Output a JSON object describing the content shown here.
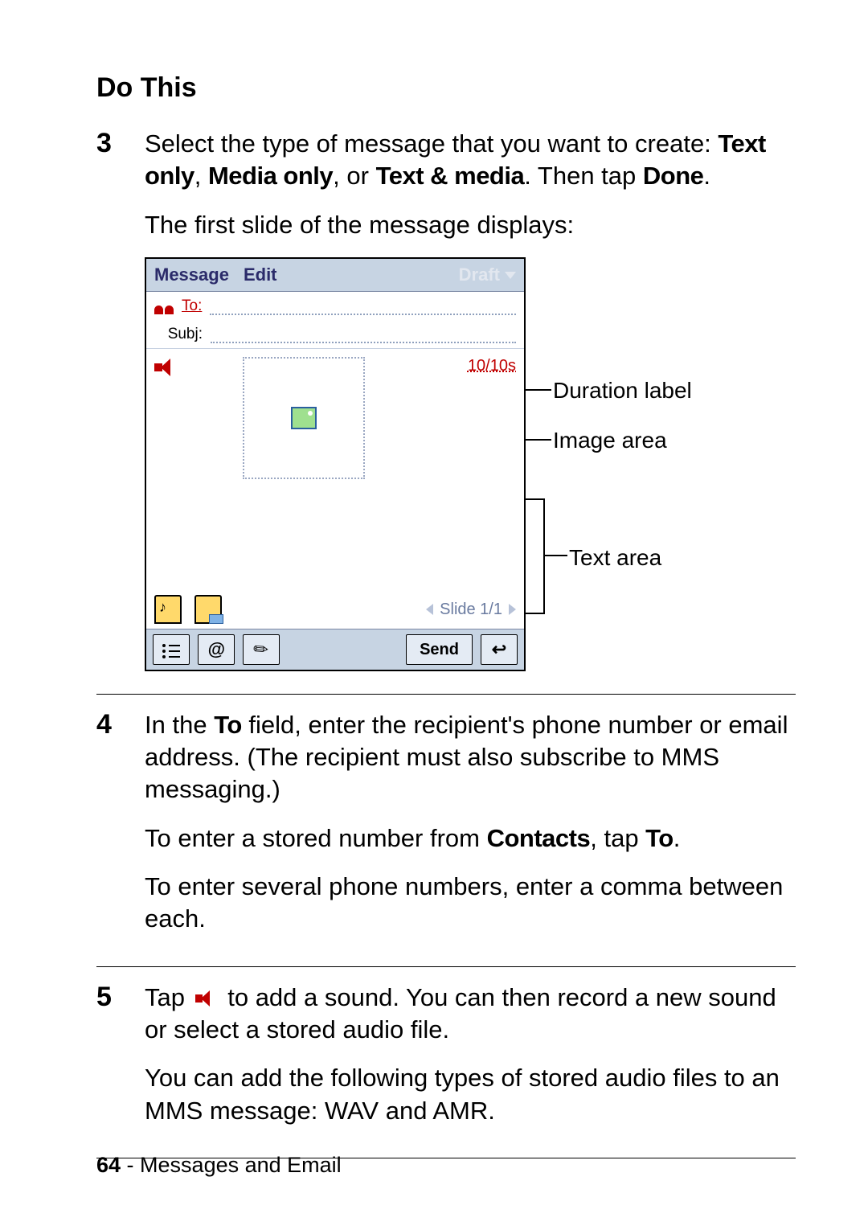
{
  "heading": "Do This",
  "steps": {
    "s3": {
      "num": "3",
      "p1_a": "Select the type of message that you want to create: ",
      "opt1": "Text only",
      "sep1": ", ",
      "opt2": "Media only",
      "sep2": ", or ",
      "opt3": "Text & media",
      "p1_b": ". Then tap ",
      "done": "Done",
      "p1_c": ".",
      "p2": "The first slide of the message displays:"
    },
    "s4": {
      "num": "4",
      "p1_a": "In the ",
      "to_bold": "To",
      "p1_b": " field, enter the recipient's phone number or email address. (The recipient must also subscribe to MMS messaging.)",
      "p2_a": "To enter a stored number from ",
      "contacts": "Contacts",
      "p2_b": ", tap ",
      "to_bold2": "To",
      "p2_c": ".",
      "p3": "To enter several phone numbers, enter a comma between each."
    },
    "s5": {
      "num": "5",
      "p1_a": "Tap ",
      "p1_b": " to add a sound. You can then record a new sound or select a stored audio file.",
      "p2": "You can add the following types of stored audio files to an MMS message: WAV and AMR."
    }
  },
  "mock": {
    "menu_message": "Message",
    "menu_edit": "Edit",
    "menu_status": "Draft",
    "to_label": "To:",
    "subj_label": "Subj:",
    "duration": "10/10s",
    "slide_nav": "Slide 1/1",
    "send": "Send",
    "at": "@"
  },
  "callouts": {
    "duration": "Duration label",
    "image": "Image area",
    "text": "Text area"
  },
  "footer": {
    "page": "64",
    "sep": " - ",
    "section": "Messages and Email"
  }
}
